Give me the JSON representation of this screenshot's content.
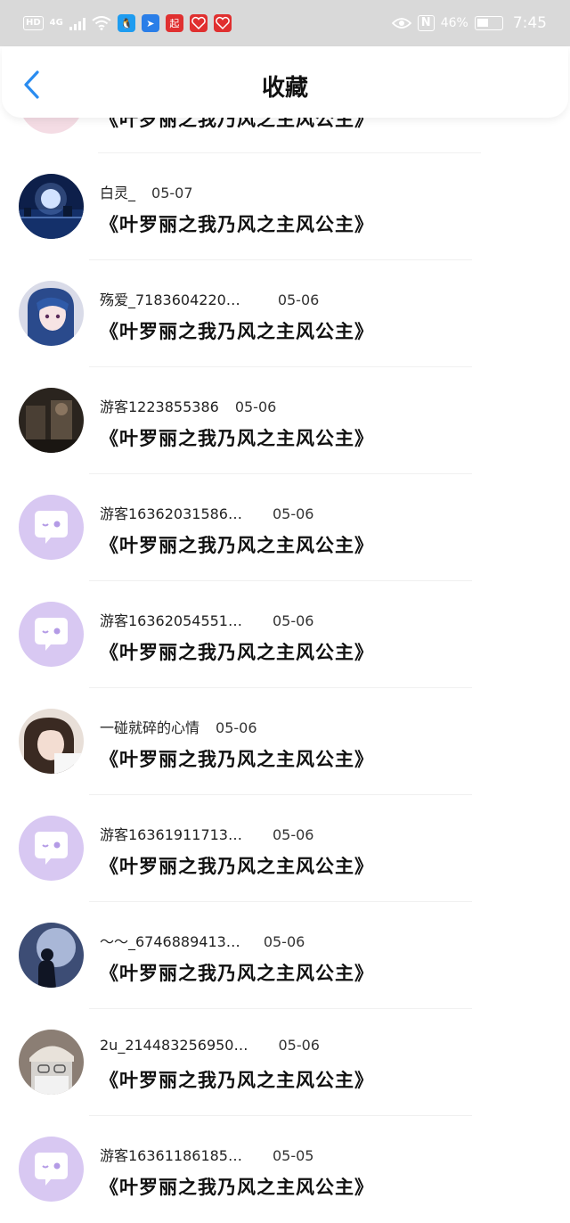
{
  "status_bar": {
    "hd": "HD",
    "network": "4G",
    "app_qq_glyph": "🐧",
    "app_arrow_glyph": "➤",
    "app_qi_label": "起",
    "battery_pct": "46%",
    "time": "7:45",
    "nfc_label": "N"
  },
  "header": {
    "title": "收藏",
    "back_icon": "chevron-left-icon",
    "accent": "#2a8cf0"
  },
  "partial_item": {
    "title": "《叶罗丽之我乃风之主风公主》"
  },
  "items": [
    {
      "name": "白灵_",
      "date": "05-07",
      "title": "《叶罗丽之我乃风之主风公主》",
      "avatar": "moon-lake"
    },
    {
      "name": "殇爱_7183604220…",
      "date": "05-06",
      "title": "《叶罗丽之我乃风之主风公主》",
      "avatar": "anime-girl"
    },
    {
      "name": "游客1223855386",
      "date": "05-06",
      "title": "《叶罗丽之我乃风之主风公主》",
      "avatar": "dark-scene"
    },
    {
      "name": "游客16362031586…",
      "date": "05-06",
      "title": "《叶罗丽之我乃风之主风公主》",
      "avatar": "default-chat"
    },
    {
      "name": "游客16362054551…",
      "date": "05-06",
      "title": "《叶罗丽之我乃风之主风公主》",
      "avatar": "default-chat"
    },
    {
      "name": "一碰就碎的心情",
      "date": "05-06",
      "title": "《叶罗丽之我乃风之主风公主》",
      "avatar": "girl-photo"
    },
    {
      "name": "游客16361911713…",
      "date": "05-06",
      "title": "《叶罗丽之我乃风之主风公主》",
      "avatar": "default-chat"
    },
    {
      "name": "～～_6746889413…",
      "date": "05-06",
      "title": "《叶罗丽之我乃风之主风公主》",
      "avatar": "night-moon"
    },
    {
      "name": "2u_214483256950…",
      "date": "05-06",
      "title": "《叶罗丽之我乃风之主风公主》",
      "avatar": "cap-person"
    },
    {
      "name": "游客16361186185…",
      "date": "05-05",
      "title": "《叶罗丽之我乃风之主风公主》",
      "avatar": "default-chat"
    }
  ],
  "colors": {
    "default_avatar_bg": "#d8c8f2",
    "status_bar_bg": "#d9d9d9"
  }
}
